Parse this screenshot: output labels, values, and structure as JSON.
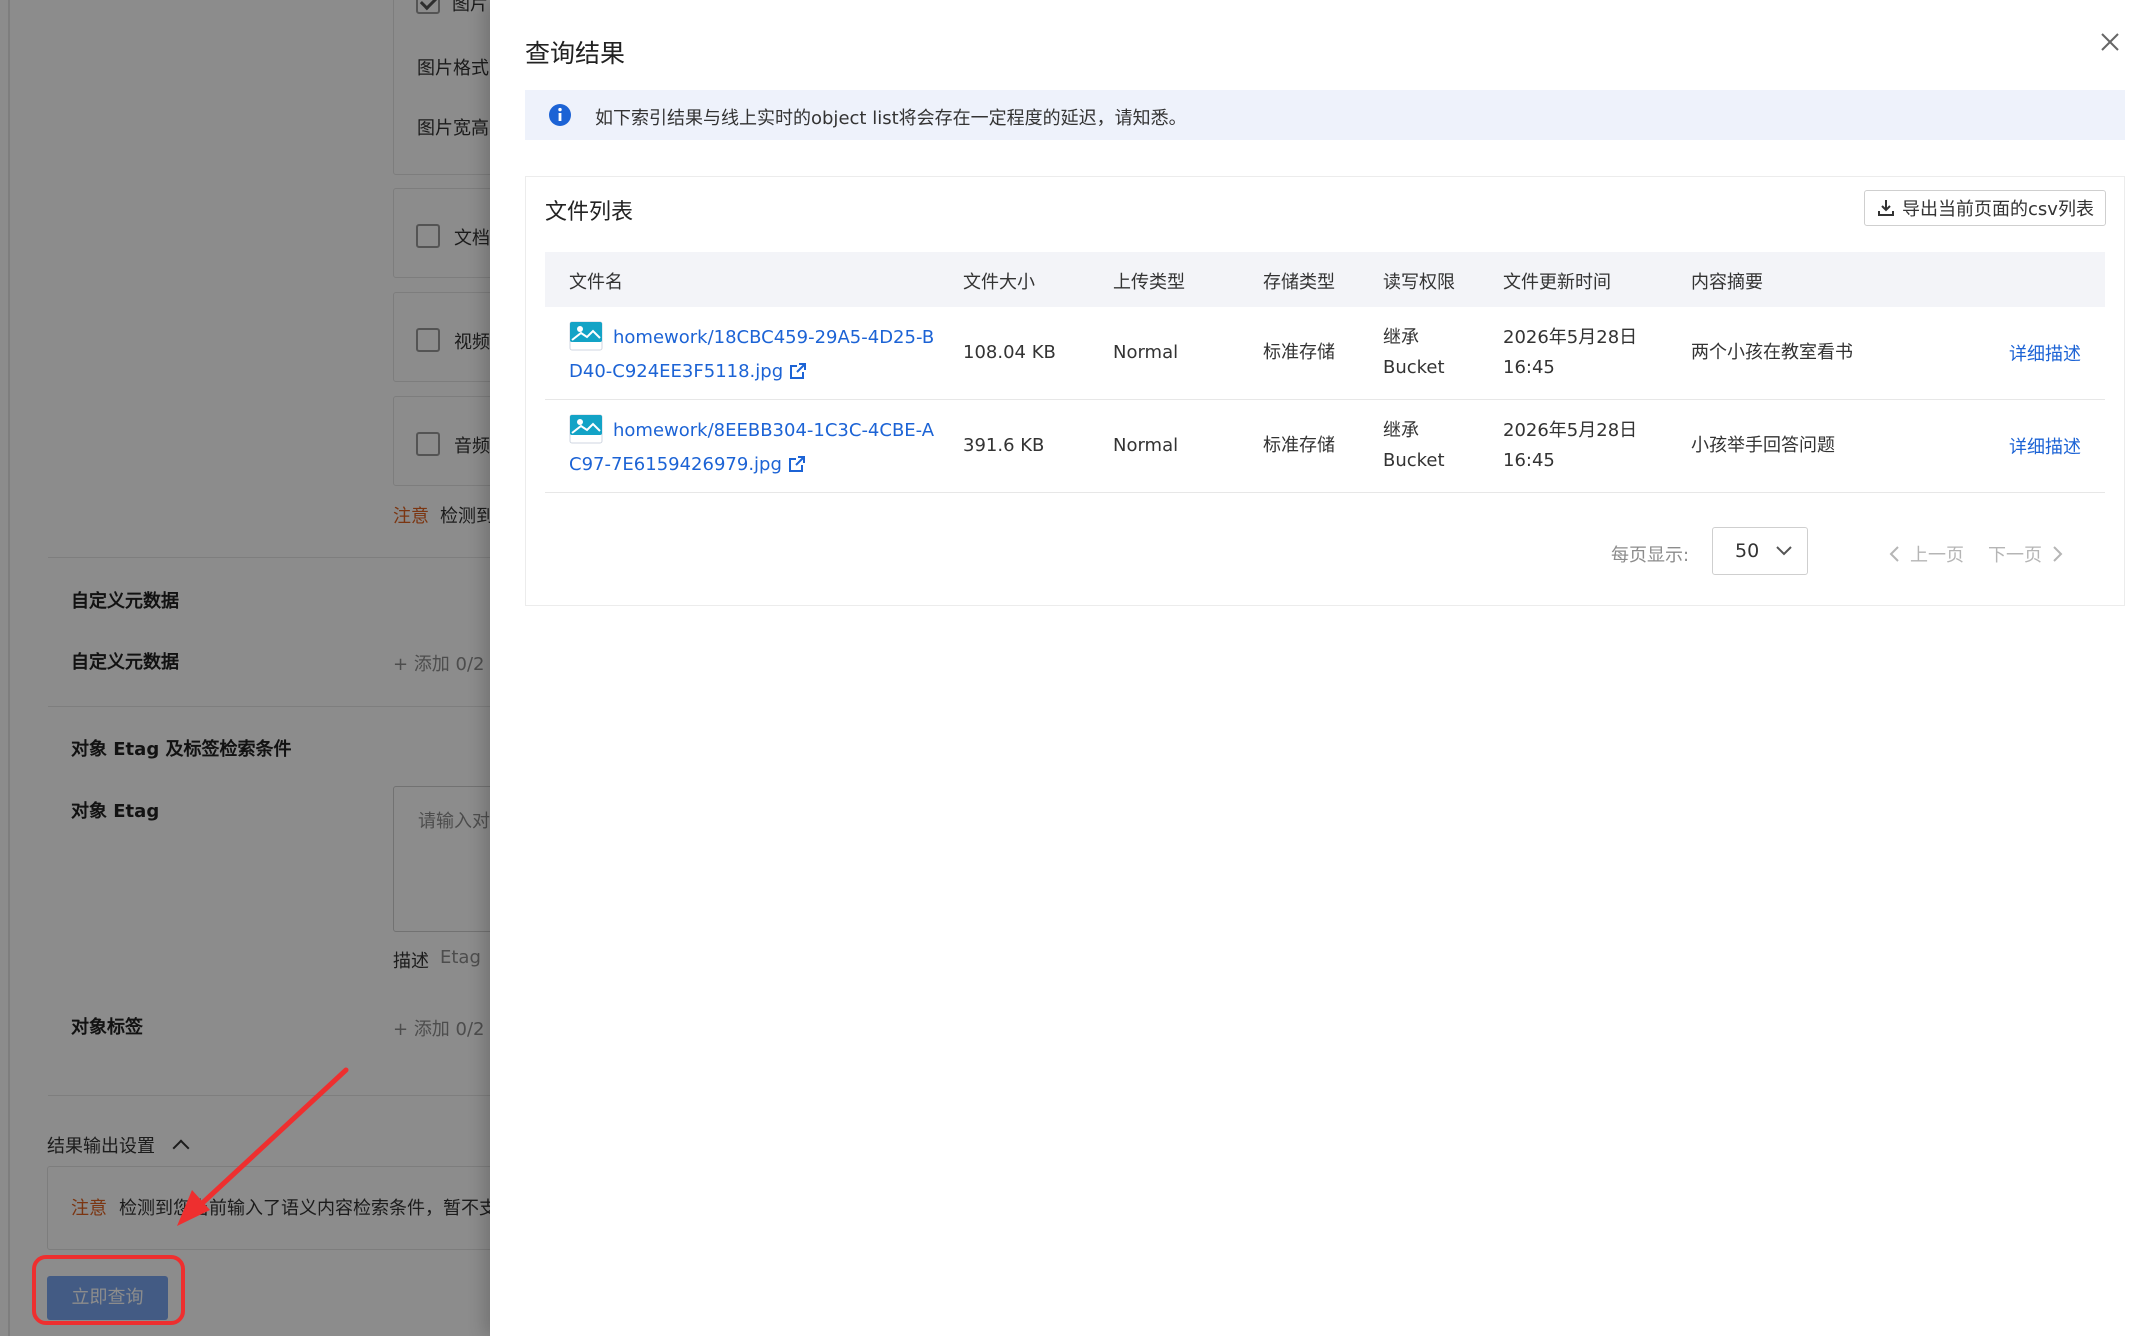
{
  "background_form": {
    "option_labels": [
      "图片",
      "文档",
      "视频",
      "音频"
    ],
    "image_format_label": "图片格式",
    "image_size_label": "图片宽高",
    "note_prefix": "注意",
    "note_text_short": "检测到",
    "custom_meta_section": "自定义元数据",
    "custom_meta_label": "自定义元数据",
    "add_custom_meta": "添加 0/2",
    "etag_section": "对象 Etag 及标签检索条件",
    "etag_label": "对象 Etag",
    "etag_placeholder": "请输入对",
    "desc_prefix": "描述",
    "desc_text": "Etag",
    "tag_label": "对象标签",
    "add_tag": "添加 0/2",
    "result_settings": "结果输出设置",
    "bottom_note_prefix": "注意",
    "bottom_note_text": "检测到您当前输入了语义内容检索条件，暂不支",
    "query_button": "立即查询"
  },
  "drawer": {
    "title": "查询结果",
    "notice": "如下索引结果与线上实时的object list将会存在一定程度的延迟，请知悉。",
    "panel_title": "文件列表",
    "export_button": "导出当前页面的csv列表",
    "columns": [
      "文件名",
      "文件大小",
      "上传类型",
      "存储类型",
      "读写权限",
      "文件更新时间",
      "内容摘要"
    ],
    "rows": [
      {
        "filename": "homework/18CBC459-29A5-4D25-BD40-C924EE3F5118.jpg",
        "size": "108.04 KB",
        "upload_type": "Normal",
        "storage_class": "标准存储",
        "acl_line1": "继承",
        "acl_line2": "Bucket",
        "updated_line1": "2026年5月28日",
        "updated_line2": "16:45",
        "summary": "两个小孩在教室看书",
        "action": "详细描述"
      },
      {
        "filename": "homework/8EEBB304-1C3C-4CBE-AC97-7E6159426979.jpg",
        "size": "391.6 KB",
        "upload_type": "Normal",
        "storage_class": "标准存储",
        "acl_line1": "继承",
        "acl_line2": "Bucket",
        "updated_line1": "2026年5月28日",
        "updated_line2": "16:45",
        "summary": "小孩举手回答问题",
        "action": "详细描述"
      }
    ],
    "pagination": {
      "page_size_label": "每页显示:",
      "page_size": "50",
      "prev": "上一页",
      "next": "下一页"
    }
  },
  "colors": {
    "link": "#1c63d5",
    "notice_bg": "#eef2fb",
    "warning": "#e0621f",
    "annotation_red": "#ee2f2f",
    "primary_button": "#7aa7f0"
  }
}
